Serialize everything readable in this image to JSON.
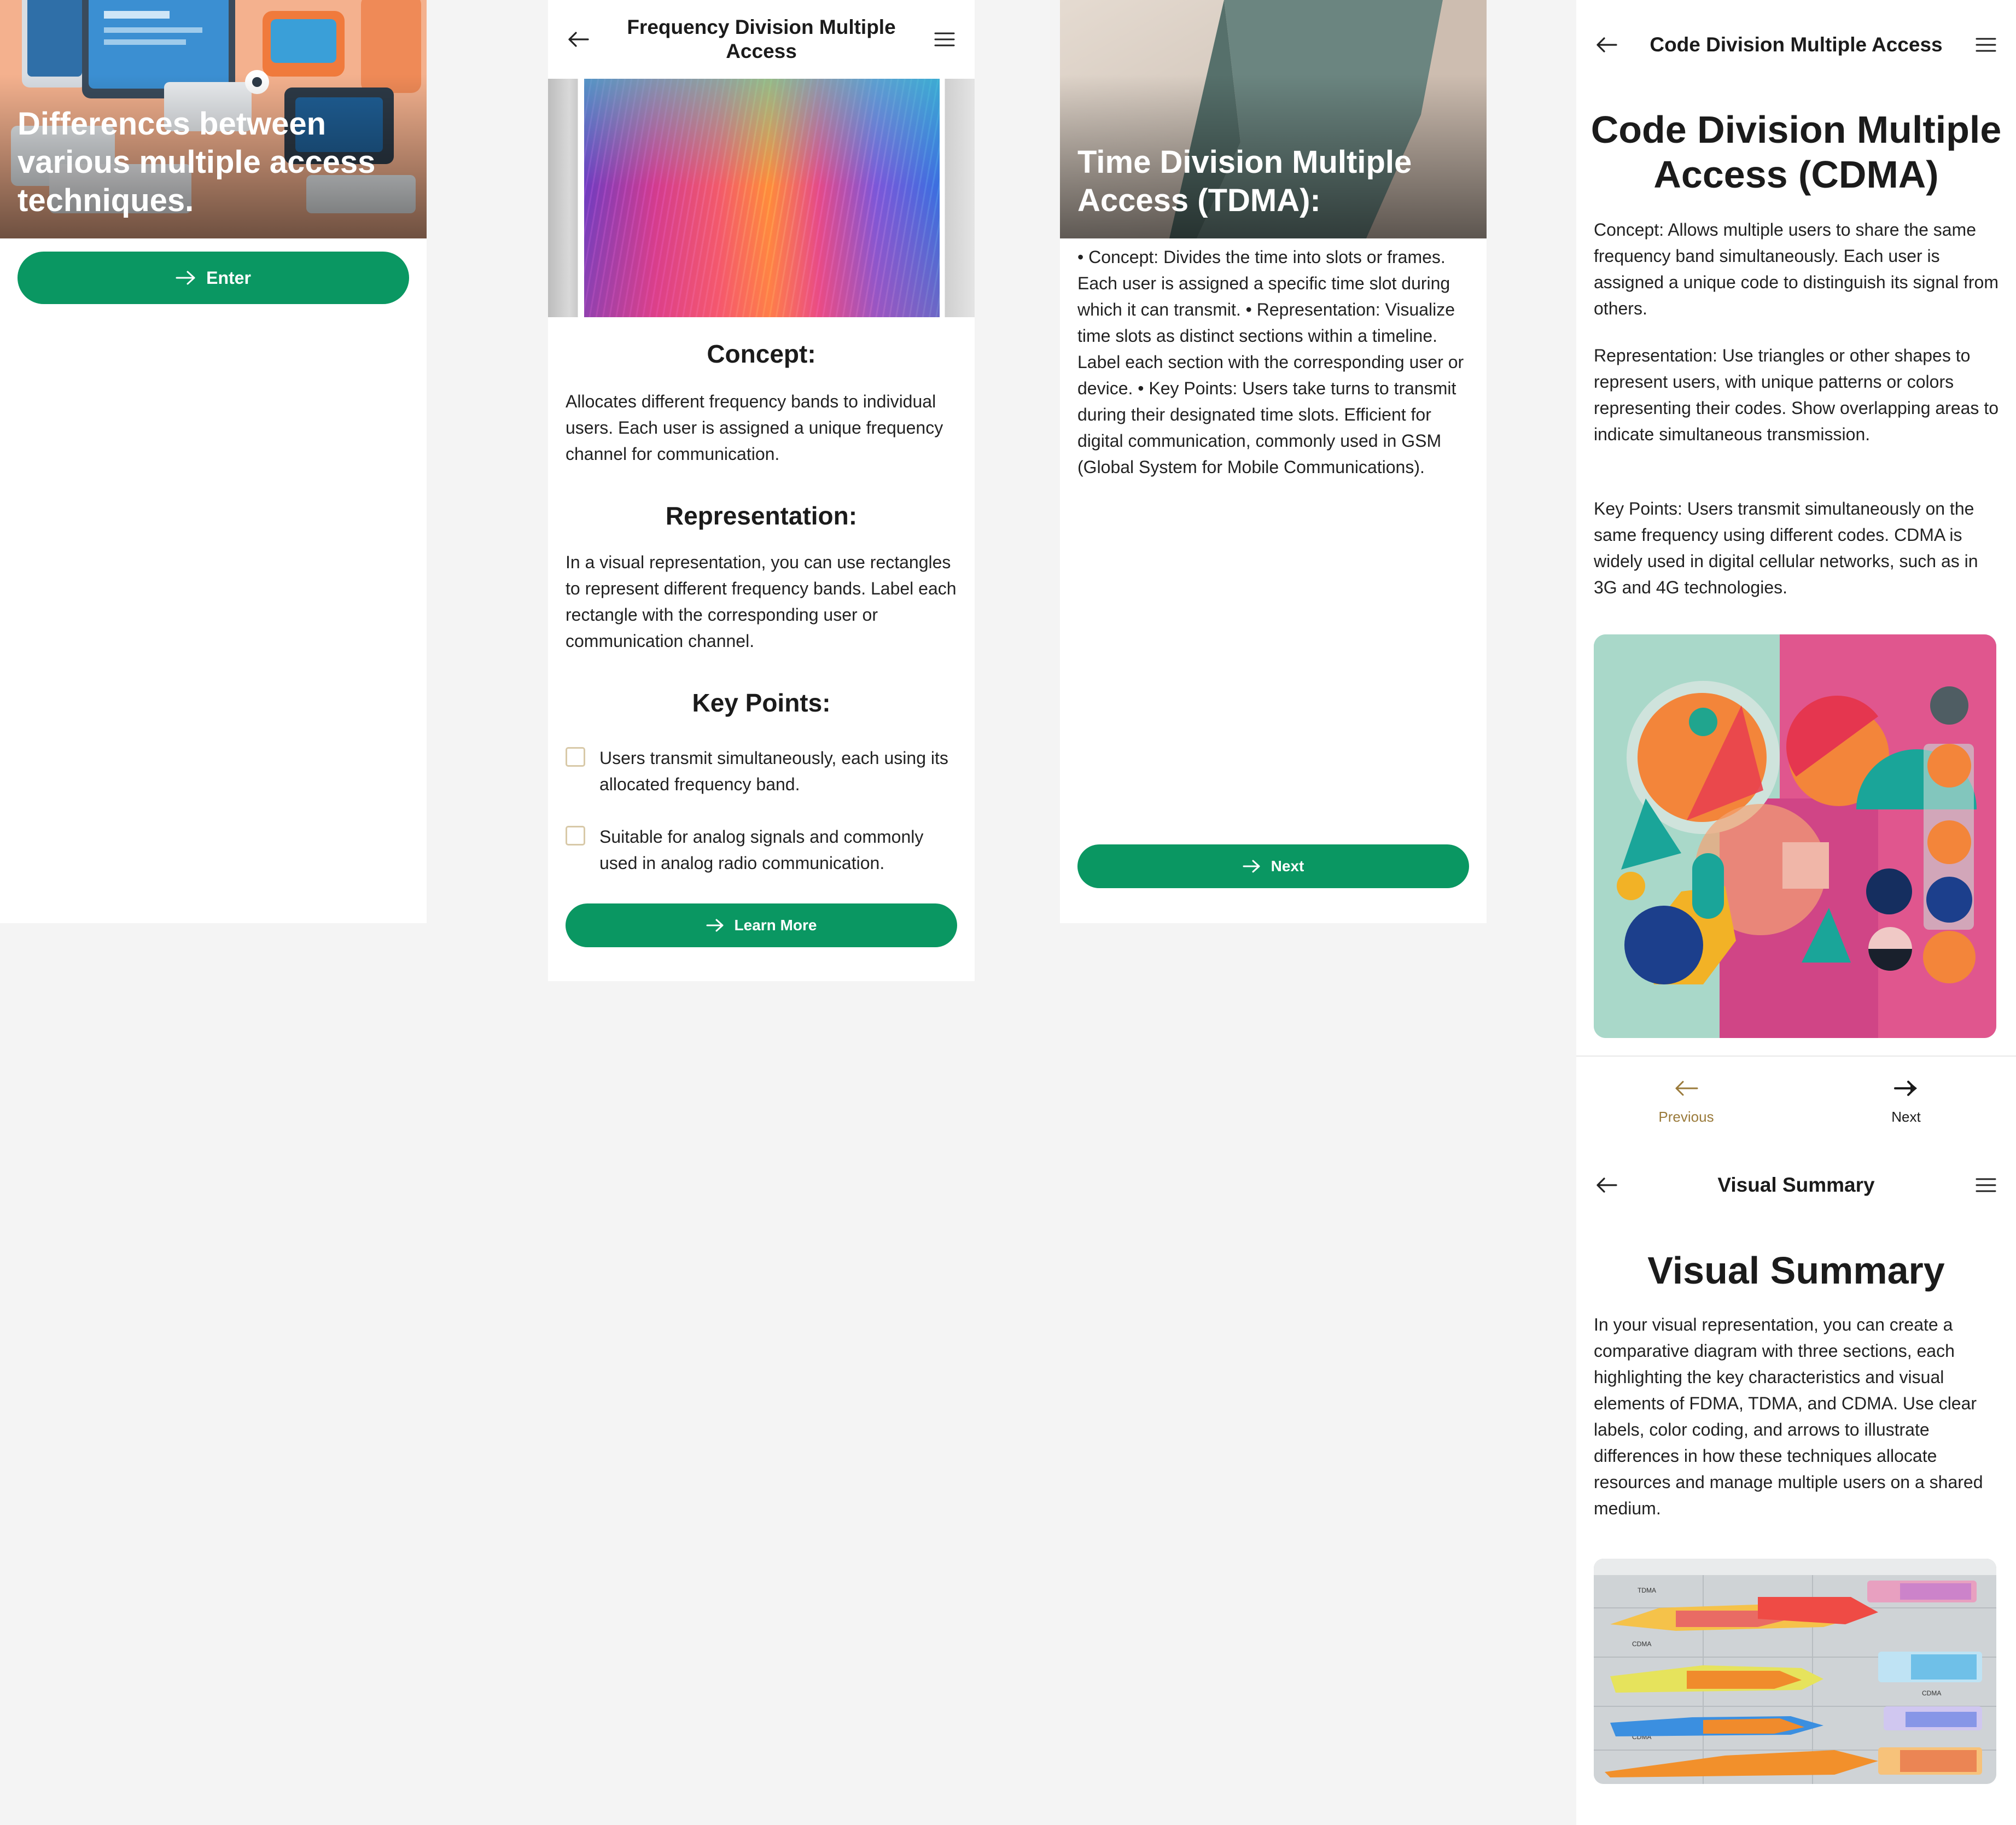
{
  "screen1": {
    "hero_title": "Differences between various multiple access techniques.",
    "enter_label": "Enter"
  },
  "screen2": {
    "header_title": "Frequency Division Multiple Access",
    "concept_heading": "Concept:",
    "concept_text": "Allocates different frequency bands to individual users. Each user is assigned a unique frequency channel for communication.",
    "representation_heading": "Representation:",
    "representation_text": "In a visual representation, you can use rectangles to represent different frequency bands. Label each rectangle with the corresponding user or communication channel.",
    "keypoints_heading": "Key Points:",
    "key_points": [
      "Users transmit simultaneously, each using its allocated frequency band.",
      "Suitable for analog signals and commonly used in analog radio communication."
    ],
    "learn_more_label": "Learn More"
  },
  "screen3": {
    "hero_title": "Time Division Multiple Access (TDMA):",
    "body_text": "• Concept: Divides the time into slots or frames. Each user is assigned a specific time slot during which it can transmit. • Representation: Visualize time slots as distinct sections within a timeline. Label each section with the corresponding user or device. • Key Points: Users take turns to transmit during their designated time slots. Efficient for digital communication, commonly used in GSM (Global System for Mobile Communications).",
    "next_label": "Next"
  },
  "screen4": {
    "header_title": "Code Division Multiple Access",
    "page_title": "Code Division Multiple Access (CDMA)",
    "concept_text": "Concept: Allows multiple users to share the same frequency band simultaneously. Each user is assigned a unique code to distinguish its signal from others.",
    "representation_text": "Representation: Use triangles or other shapes to represent users, with unique patterns or colors representing their codes. Show overlapping areas to indicate simultaneous transmission.",
    "keypoints_text": "Key Points: Users transmit simultaneously on the same frequency using different codes. CDMA is widely used in digital cellular networks, such as in 3G and 4G technologies.",
    "nav_previous": "Previous",
    "nav_next": "Next"
  },
  "screen5": {
    "header_title": "Visual Summary",
    "page_title": "Visual Summary",
    "body_text": "In your visual representation, you can create a comparative diagram with three sections, each highlighting the key characteristics and visual elements of FDMA, TDMA, and CDMA. Use clear labels, color coding, and arrows to illustrate differences in how these techniques allocate resources and manage multiple users on a shared medium.",
    "diagram_labels": [
      "TDMA",
      "CDMA",
      "CDMA",
      "CDMA"
    ]
  },
  "colors": {
    "accent_green": "#0a9762",
    "nav_previous_color": "#9a7a3a",
    "background": "#f4f4f4"
  },
  "icons": [
    "arrow-left-icon",
    "menu-icon",
    "arrow-right-icon"
  ]
}
